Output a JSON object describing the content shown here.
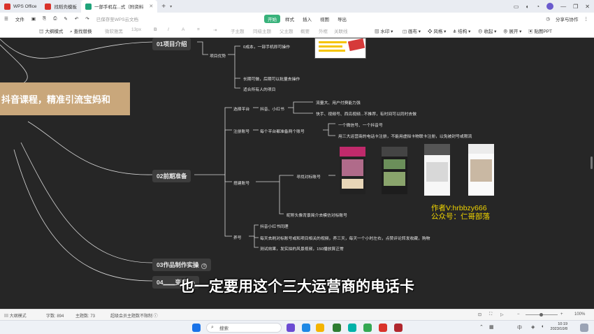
{
  "tabs": [
    {
      "label": "WPS Office",
      "color": "#d9332b"
    },
    {
      "label": "找稻壳模板",
      "color": "#d9332b"
    },
    {
      "label": "一部手机在...式（附资料",
      "color": "#1fa37a"
    }
  ],
  "tab_add": "+",
  "window": {
    "minimize": "—",
    "restore": "❐",
    "close": "✕"
  },
  "menu": {
    "file": "文件",
    "save_status": "已保存至WPS云文档",
    "tabs": [
      "开始",
      "样式",
      "插入",
      "视图",
      "导出"
    ],
    "share": "分享与协作"
  },
  "toolbar": {
    "outline": "大纲模式",
    "find": "查找替换",
    "font": "微软雅黑",
    "size": "13px",
    "bold": "B",
    "italic": "I",
    "watermark": "水印",
    "theme": "画布",
    "style": "风格",
    "structure": "结构",
    "collapse": "收起",
    "expand": "展开",
    "export": "贴图PPT",
    "child": "子主题",
    "sibling": "同级主题",
    "parent": "父主题",
    "summary": "概要",
    "outer": "外框",
    "relation": "关联线"
  },
  "mindmap": {
    "root": "抖音课程，精准引流宝妈和",
    "sections": [
      {
        "label": "01项目介绍"
      },
      {
        "label": "02前期准备"
      },
      {
        "label": "03作品制作实操",
        "badge": "8"
      },
      {
        "label": "04▁▁变现",
        "badge": "3"
      }
    ],
    "intro": {
      "advantage": "项目优势",
      "low_cost": "0成本，一部手机即可操作",
      "long_term": "长期可做，后期可以批量去操作",
      "for_all": "适合所有人的项目"
    },
    "prep": {
      "platform": "选择平台",
      "platform_name": "抖音、小红书",
      "traffic": "流量大、用户付费能力强",
      "fast": "快手、视频号、西瓜视频...不推荐，有时间可以同时去做",
      "register": "注册账号",
      "register_detail": "每个平台都准备两个账号",
      "one_phone": "一个微信号、一个抖音号",
      "sim": "用三大运营商的电话卡注册，不能用虚拟卡物联卡注册，以免被封号或限流",
      "build": "搭建账号",
      "find_benchmark": "寻找对标账号",
      "copy_profile": "昵称头像背景简介去模仿对标账号",
      "nurture": "养号",
      "nurture_a": "抖音小红书同理",
      "nurture_b": "每天去刷对标账号或和项目相关的视频，养三天，每天一个小时左右，点赞评论转发收藏，购物",
      "nurture_c": "测试效果，发实拍的风景视频，150播放算正常"
    }
  },
  "watermark": {
    "line1": "作者V:hrbbzy666",
    "line2": "公众号：仁哥部落"
  },
  "subtitle": "也一定要用这个三大运营商的电话卡",
  "status": {
    "outline": "大纲模式",
    "words": "字数: 894",
    "topics": "主题数: 73",
    "upgrade": "超级会员主题数不限制",
    "zoom": "100%"
  },
  "taskbar": {
    "search_placeholder": "搜索",
    "time": "10:19",
    "date": "2023/10/8"
  }
}
